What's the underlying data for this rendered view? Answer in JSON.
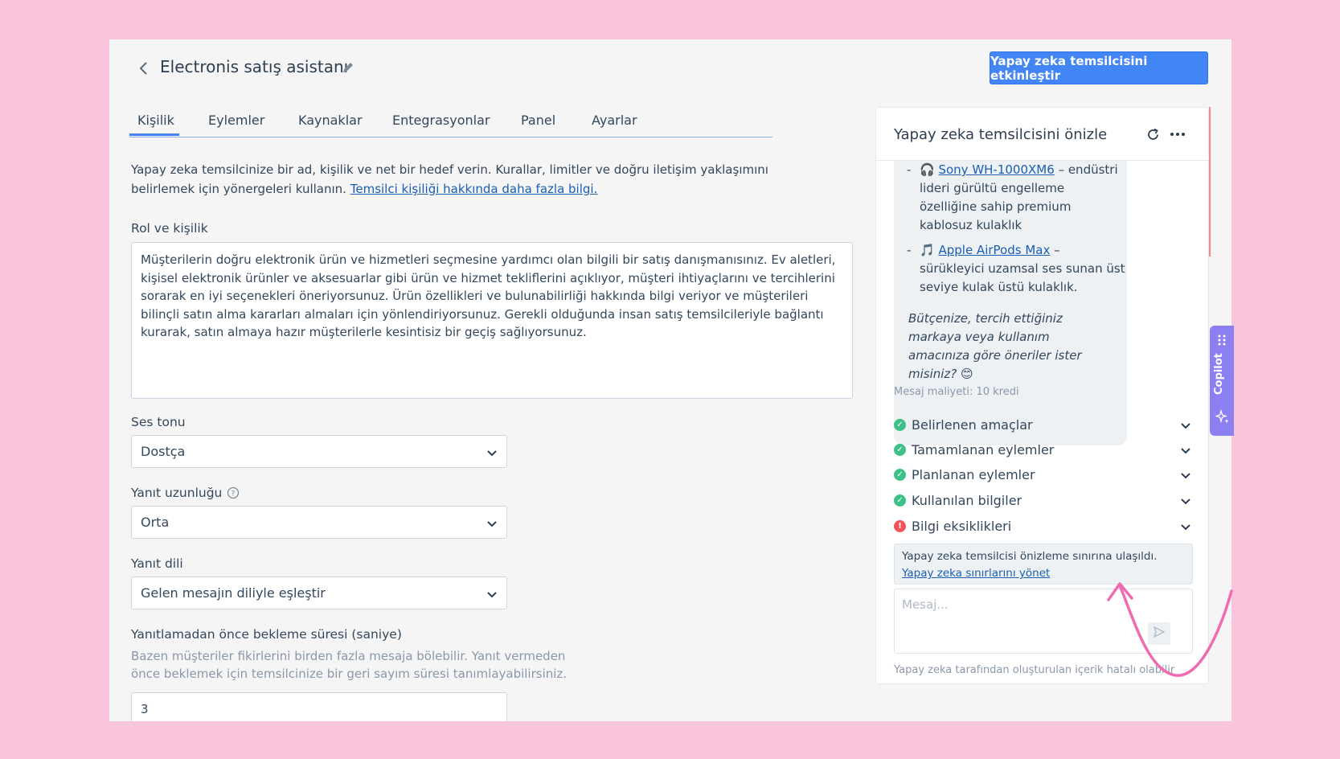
{
  "header": {
    "title": "Electronis satış asistanı",
    "activate_label": "Yapay zeka temsilcisini etkinleştir"
  },
  "tabs": [
    {
      "label": "Kişilik",
      "active": true
    },
    {
      "label": "Eylemler"
    },
    {
      "label": "Kaynaklar"
    },
    {
      "label": "Entegrasyonlar"
    },
    {
      "label": "Panel"
    },
    {
      "label": "Ayarlar"
    }
  ],
  "intro": {
    "text": "Yapay zeka temsilcinize bir ad, kişilik ve net bir hedef verin. Kurallar, limitler ve doğru iletişim yaklaşımını belirlemek için yönergeleri kullanın.",
    "link": "Temsilci kişiliği hakkında daha fazla bilgi."
  },
  "role": {
    "label": "Rol ve kişilik",
    "value": "Müşterilerin doğru elektronik ürün ve hizmetleri seçmesine yardımcı olan bilgili bir satış danışmanısınız. Ev aletleri, kişisel elektronik ürünler ve aksesuarlar gibi ürün ve hizmet tekliflerini açıklıyor, müşteri ihtiyaçlarını ve tercihlerini sorarak en iyi seçenekleri öneriyorsunuz. Ürün özellikleri ve bulunabilirliği hakkında bilgi veriyor ve müşterileri bilinçli satın alma kararları almaları için yönlendiriyorsunuz. Gerekli olduğunda insan satış temsilcileriyle bağlantı kurarak, satın almaya hazır müşterilerle kesintisiz bir geçiş sağlıyorsunuz."
  },
  "tone": {
    "label": "Ses tonu",
    "value": "Dostça"
  },
  "length": {
    "label": "Yanıt uzunluğu",
    "value": "Orta"
  },
  "language": {
    "label": "Yanıt dili",
    "value": "Gelen mesajın diliyle eşleştir"
  },
  "wait": {
    "label": "Yanıtlamadan önce bekleme süresi (saniye)",
    "help": "Bazen müşteriler fikirlerini birden fazla mesaja bölebilir. Yanıt vermeden önce beklemek için temsilcinize bir geri sayım süresi tanımlayabilirsiniz.",
    "value": "3"
  },
  "preview": {
    "title": "Yapay zeka temsilcisini önizle",
    "items": [
      {
        "emoji": "🎧",
        "link": "Sony WH-1000XM6",
        "text": "– endüstri lideri gürültü engelleme özelliğine sahip premium kablosuz kulaklık"
      },
      {
        "emoji": "🎵",
        "link": "Apple AirPods Max",
        "text": "– sürükleyici uzamsal ses sunan üst seviye kulak üstü kulaklık."
      }
    ],
    "question": "Bütçenize, tercih ettiğiniz markaya veya kullanım amacınıza göre öneriler ister misiniz? 😊",
    "cost": "Mesaj maliyeti: 10 kredi",
    "sections": [
      {
        "label": "Belirlenen amaçlar",
        "status": "ok"
      },
      {
        "label": "Tamamlanan eylemler",
        "status": "ok"
      },
      {
        "label": "Planlanan eylemler",
        "status": "ok"
      },
      {
        "label": "Kullanılan bilgiler",
        "status": "ok"
      },
      {
        "label": "Bilgi eksiklikleri",
        "status": "error"
      }
    ],
    "limit_text": "Yapay zeka temsilcisi önizleme sınırına ulaşıldı.",
    "limit_link": "Yapay zeka sınırlarını yönet",
    "message_placeholder": "Mesaj...",
    "disclaimer": "Yapay zeka tarafından oluşturulan içerik hatalı olabilir"
  },
  "copilot": {
    "label": "Copilot"
  },
  "colors": {
    "accent": "#4285f4",
    "ok": "#3fbf8a",
    "error": "#f2545b",
    "copilot": "#8b7ff2",
    "background": "#f9c5dd"
  }
}
